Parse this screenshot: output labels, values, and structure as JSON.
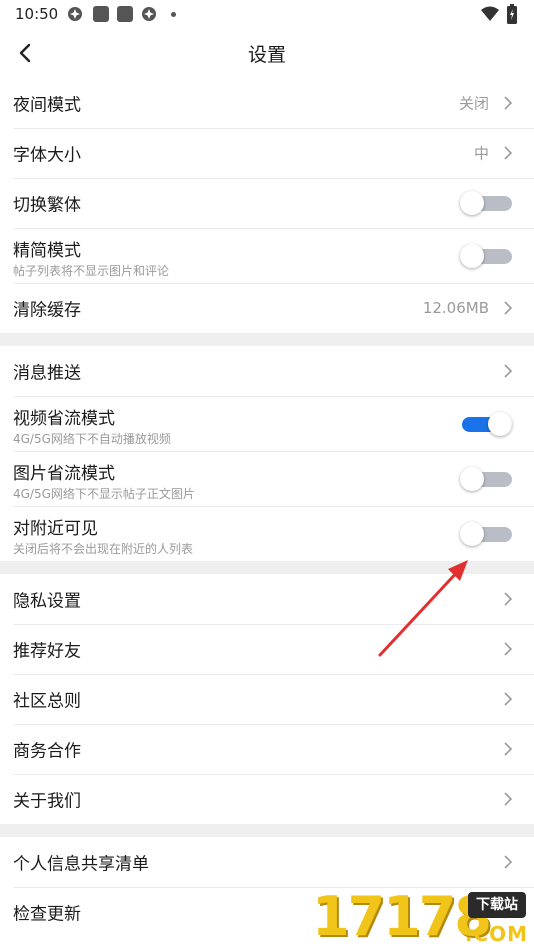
{
  "status_bar": {
    "time": "10:50",
    "icons": [
      "app-notification-icon",
      "app-square-icon",
      "app-square-icon",
      "app-notification-icon",
      "more-dot-icon"
    ],
    "right_icons": [
      "wifi-icon",
      "battery-charging-icon"
    ]
  },
  "header": {
    "title": "设置",
    "back_icon": "chevron-left-icon"
  },
  "section1": {
    "night_mode": {
      "label": "夜间模式",
      "value": "关闭"
    },
    "font_size": {
      "label": "字体大小",
      "value": "中"
    },
    "traditional": {
      "label": "切换繁体",
      "enabled": false
    },
    "lite_mode": {
      "label": "精简模式",
      "sub": "帖子列表将不显示图片和评论",
      "enabled": false
    },
    "clear_cache": {
      "label": "清除缓存",
      "value": "12.06MB"
    }
  },
  "section2": {
    "push": {
      "label": "消息推送"
    },
    "video_saver": {
      "label": "视频省流模式",
      "sub": "4G/5G网络下不自动播放视频",
      "enabled": true
    },
    "image_saver": {
      "label": "图片省流模式",
      "sub": "4G/5G网络下不显示帖子正文图片",
      "enabled": false
    },
    "nearby_visible": {
      "label": "对附近可见",
      "sub": "关闭后将不会出现在附近的人列表",
      "enabled": false
    }
  },
  "section3": {
    "privacy": {
      "label": "隐私设置"
    },
    "recommend_friends": {
      "label": "推荐好友"
    },
    "community_rules": {
      "label": "社区总则"
    },
    "business": {
      "label": "商务合作"
    },
    "about": {
      "label": "关于我们"
    }
  },
  "section4": {
    "info_share": {
      "label": "个人信息共享清单"
    },
    "check_update": {
      "label": "检查更新"
    }
  },
  "annotation": {
    "arrow_color": "#e03030"
  },
  "watermark": {
    "digits": "17178",
    "badge": "下载站",
    "domain": ".COM"
  },
  "colors": {
    "accent": "#1a73e8",
    "toggle_off": "#b9bdc6",
    "section_gap": "#efefef"
  }
}
